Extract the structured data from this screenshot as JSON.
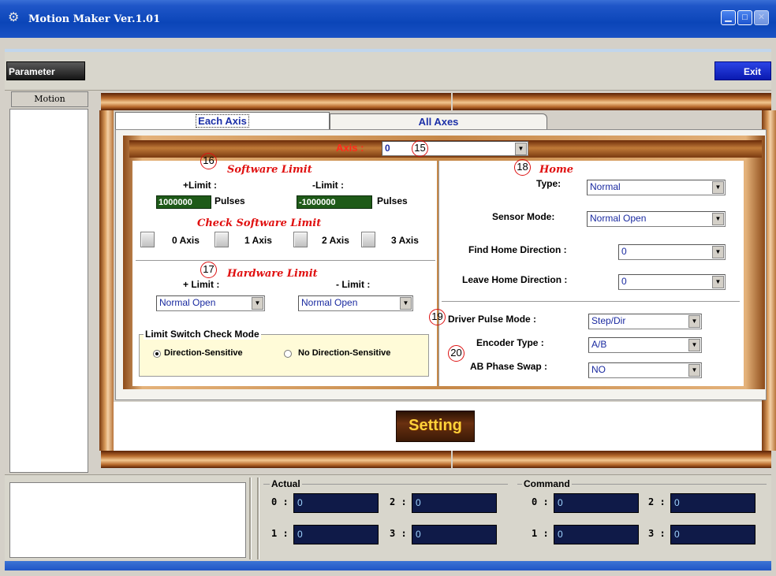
{
  "window": {
    "title": "Motion Maker Ver.1.01"
  },
  "toolbar": {
    "parameter_label": "Parameter",
    "exit_label": "Exit"
  },
  "left_panel": {
    "tab_label": "Motion"
  },
  "tabs": [
    {
      "label": "Each Axis"
    },
    {
      "label": "All Axes"
    }
  ],
  "axis_selector": {
    "label": "Axis :",
    "value": "0"
  },
  "callouts": [
    "15",
    "16",
    "17",
    "18",
    "19",
    "20"
  ],
  "software_limit": {
    "title": "Software Limit",
    "plus_label": "+Limit :",
    "minus_label": "-Limit :",
    "plus_value": "1000000",
    "minus_value": "-1000000",
    "unit": "Pulses",
    "check_title": "Check Software Limit",
    "axes": [
      "0 Axis",
      "1 Axis",
      "2 Axis",
      "3 Axis"
    ]
  },
  "hardware_limit": {
    "title": "Hardware Limit",
    "plus_label": "+ Limit :",
    "minus_label": "- Limit :",
    "plus_value": "Normal Open",
    "minus_value": "Normal Open",
    "check_mode_title": "Limit Switch Check Mode",
    "option_sensitive": "Direction-Sensitive",
    "option_no_sensitive": "No Direction-Sensitive"
  },
  "home": {
    "title": "Home",
    "type_label": "Type:",
    "type_value": "Normal",
    "sensor_label": "Sensor Mode:",
    "sensor_value": "Normal Open",
    "find_label": "Find Home Direction :",
    "find_value": "0",
    "leave_label": "Leave Home Direction :",
    "leave_value": "0"
  },
  "driver": {
    "pulse_label": "Driver Pulse Mode :",
    "pulse_value": "Step/Dir",
    "encoder_label": "Encoder Type :",
    "encoder_value": "A/B",
    "swap_label": "AB Phase Swap :",
    "swap_value": "NO"
  },
  "setting_button": "Setting",
  "actual": {
    "title": "Actual",
    "labels": [
      "0 :",
      "1 :",
      "2 :",
      "3 :"
    ],
    "values": [
      "0",
      "0",
      "0",
      "0"
    ]
  },
  "command": {
    "title": "Command",
    "labels": [
      "0 :",
      "1 :",
      "2 :",
      "3 :"
    ],
    "values": [
      "0",
      "0",
      "0",
      "0"
    ]
  },
  "colors": {
    "titlebar": "#0b45b8",
    "wood": "#b86a2c",
    "green_field": "#1e5a18",
    "navy_field": "#0f1a48",
    "tab_text": "#1c30a8",
    "section_title": "#e01010"
  }
}
